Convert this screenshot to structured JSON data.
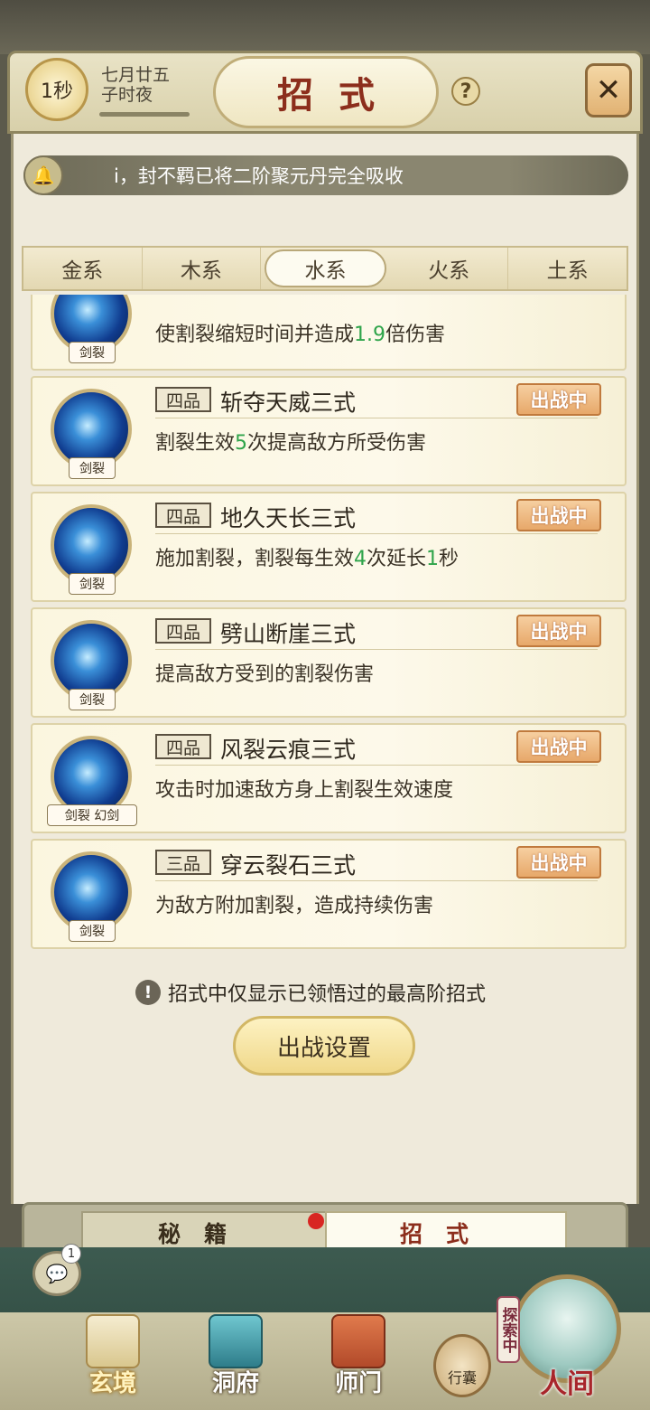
{
  "header": {
    "timer": "1秒",
    "date_line1": "七月廿五",
    "date_line2": "子时夜",
    "title": "招式",
    "help_icon": "question-icon",
    "close_icon": "close-icon"
  },
  "ticker": {
    "icon": "bell-icon",
    "message": "i，封不羁已将二阶聚元丹完全吸收"
  },
  "element_tabs": [
    "金系",
    "木系",
    "水系",
    "火系",
    "土系"
  ],
  "active_element_tab": "水系",
  "skills": [
    {
      "grade": "",
      "name": "",
      "desc_pre": "使割裂缩短时间并造成",
      "desc_num": "1.9",
      "desc_post": "倍伤害",
      "desc_num2": "",
      "desc_post2": "",
      "tag": "剑裂",
      "badge": ""
    },
    {
      "grade": "四品",
      "name": "斩夺天威三式",
      "desc_pre": "割裂生效",
      "desc_num": "5",
      "desc_post": "次提高敌方所受伤害",
      "desc_num2": "",
      "desc_post2": "",
      "tag": "剑裂",
      "badge": "出战中"
    },
    {
      "grade": "四品",
      "name": "地久天长三式",
      "desc_pre": "施加割裂，割裂每生效",
      "desc_num": "4",
      "desc_post": "次延长",
      "desc_num2": "1",
      "desc_post2": "秒",
      "tag": "剑裂",
      "badge": "出战中"
    },
    {
      "grade": "四品",
      "name": "劈山断崖三式",
      "desc_pre": "提高敌方受到的割裂伤害",
      "desc_num": "",
      "desc_post": "",
      "desc_num2": "",
      "desc_post2": "",
      "tag": "剑裂",
      "badge": "出战中"
    },
    {
      "grade": "四品",
      "name": "风裂云痕三式",
      "desc_pre": "攻击时加速敌方身上割裂生效速度",
      "desc_num": "",
      "desc_post": "",
      "desc_num2": "",
      "desc_post2": "",
      "tag": "剑裂 幻剑",
      "badge": "出战中"
    },
    {
      "grade": "三品",
      "name": "穿云裂石三式",
      "desc_pre": "为敌方附加割裂，造成持续伤害",
      "desc_num": "",
      "desc_post": "",
      "desc_num2": "",
      "desc_post2": "",
      "tag": "剑裂",
      "badge": "出战中"
    }
  ],
  "notice": "招式中仅显示已领悟过的最高阶招式",
  "battle_button": "出战设置",
  "bottom_tabs": {
    "left": "秘籍",
    "right": "招式"
  },
  "chat": {
    "icon": "chat-icon",
    "count": "1"
  },
  "nav": [
    {
      "label": "玄境",
      "icon": "scroll-icon"
    },
    {
      "label": "洞府",
      "icon": "pavilion-icon"
    },
    {
      "label": "师门",
      "icon": "banner-icon"
    }
  ],
  "bag_label": "行囊",
  "explore_label": "探索中",
  "world_label": "人间",
  "colors": {
    "accent": "#8c2e1c",
    "highlight_number": "#2ea44a",
    "badge": "#e7a86a"
  }
}
